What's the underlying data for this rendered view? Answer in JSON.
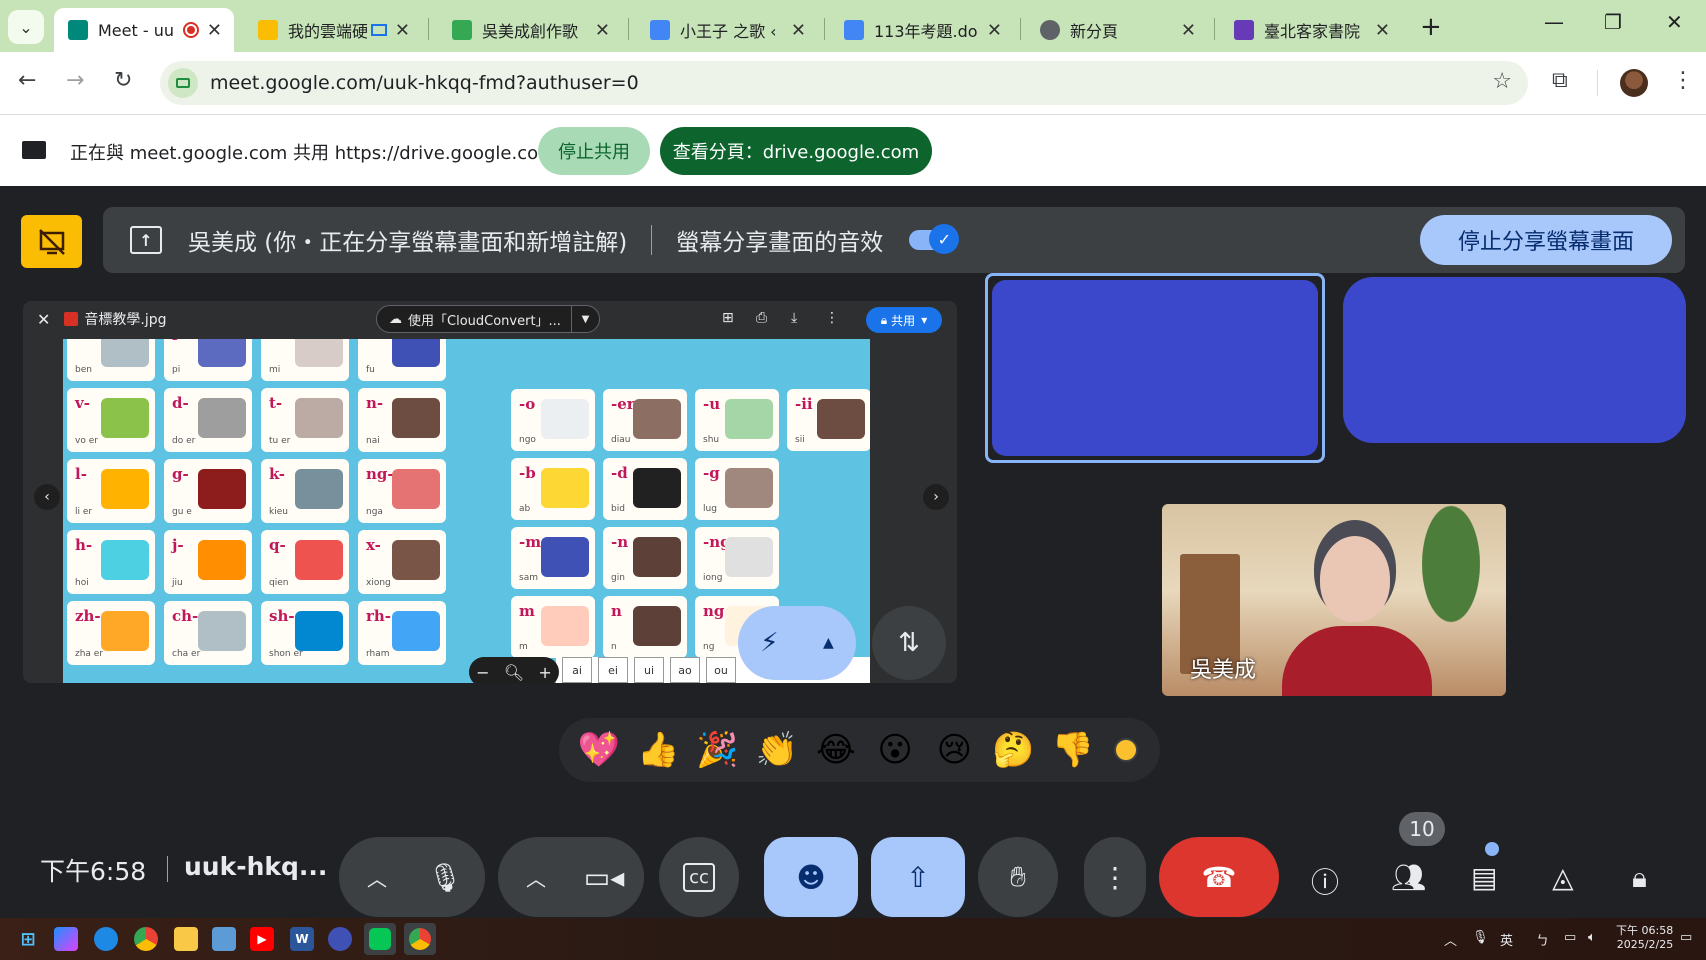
{
  "browser": {
    "tabs": [
      {
        "label": "Meet - uu",
        "favicon_color": "#00897b",
        "active": true,
        "recording": true
      },
      {
        "label": "我的雲端硬",
        "favicon_color": "#fbbc04",
        "extra": "cast"
      },
      {
        "label": "吳美成創作歌",
        "favicon_color": "#34a853"
      },
      {
        "label": "小王子 之歌 ‹",
        "favicon_color": "#4285f4"
      },
      {
        "label": "113年考題.do",
        "favicon_color": "#4285f4"
      },
      {
        "label": "新分頁",
        "favicon_color": "#5f6368"
      },
      {
        "label": "臺北客家書院",
        "favicon_color": "#673ab7"
      }
    ],
    "url": "meet.google.com/uuk-hkqq-fmd?authuser=0"
  },
  "share_bar": {
    "message": "正在與 meet.google.com 共用 https://drive.google.com",
    "stop_label": "停止共用",
    "view_label": "查看分頁：drive.google.com"
  },
  "banner": {
    "text": "吳美成 (你・正在分享螢幕畫面和新增註解)",
    "audio_label": "螢幕分享畫面的音效",
    "stop_button": "停止分享螢幕畫面"
  },
  "shared_view": {
    "file_name": "音標教學.jpg",
    "open_with": "使用「CloudConvert」...",
    "share_label": "共用",
    "cards": [
      {
        "label": "b-",
        "sub": "ben"
      },
      {
        "label": "p-",
        "sub": "pi"
      },
      {
        "label": "m-",
        "sub": "mi"
      },
      {
        "label": "f-",
        "sub": "fu"
      },
      {
        "label": "v-",
        "sub": "vo er"
      },
      {
        "label": "d-",
        "sub": "do er"
      },
      {
        "label": "t-",
        "sub": "tu er"
      },
      {
        "label": "n-",
        "sub": "nai"
      },
      {
        "label": "l-",
        "sub": "li er"
      },
      {
        "label": "g-",
        "sub": "gu e"
      },
      {
        "label": "k-",
        "sub": "kieu"
      },
      {
        "label": "ng-",
        "sub": "nga"
      },
      {
        "label": "h-",
        "sub": "hoi"
      },
      {
        "label": "j-",
        "sub": "jiu"
      },
      {
        "label": "q-",
        "sub": "qien"
      },
      {
        "label": "x-",
        "sub": "xiong"
      },
      {
        "label": "zh-",
        "sub": "zha er"
      },
      {
        "label": "ch-",
        "sub": "cha er"
      },
      {
        "label": "sh-",
        "sub": "shon er"
      },
      {
        "label": "rh-",
        "sub": "rham"
      }
    ],
    "finals": [
      {
        "label": "-o",
        "sub": "ngo"
      },
      {
        "label": "-er",
        "sub": "diau"
      },
      {
        "label": "-u",
        "sub": "shu"
      },
      {
        "label": "-ii",
        "sub": "sii"
      },
      {
        "label": "-b",
        "sub": "ab"
      },
      {
        "label": "-d",
        "sub": "bid"
      },
      {
        "label": "-g",
        "sub": "lug"
      },
      {
        "label": "-m",
        "sub": "sam"
      },
      {
        "label": "-n",
        "sub": "gin"
      },
      {
        "label": "-ng",
        "sub": "iong"
      },
      {
        "label": "m",
        "sub": "m"
      },
      {
        "label": "n",
        "sub": "n"
      },
      {
        "label": "ng",
        "sub": "ng"
      }
    ],
    "table_header": [
      "ai",
      "ei",
      "ui",
      "ao",
      "ou"
    ]
  },
  "participants": {
    "name": "吳美成"
  },
  "reactions": [
    "💖",
    "👍",
    "🎉",
    "👏",
    "😂",
    "😮",
    "😢",
    "🤔",
    "👎"
  ],
  "controls": {
    "time": "下午6:58",
    "meeting_code": "uuk-hkq...",
    "people_count": "10"
  },
  "taskbar": {
    "ime_label": "英",
    "time": "下午 06:58",
    "date": "2025/2/25"
  },
  "colors": {
    "meet_bg": "#202124",
    "accent_blue": "#a8c7fa",
    "hangup_red": "#dc362e",
    "present_yellow": "#fbbc04",
    "tile_blue": "#3b48cc"
  }
}
